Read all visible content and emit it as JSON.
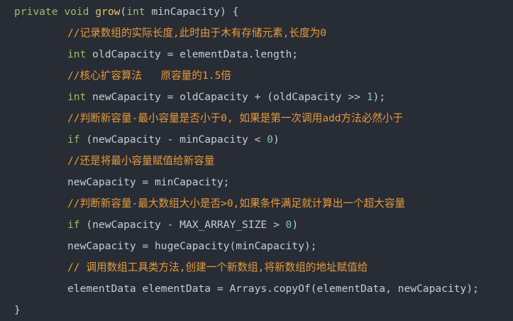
{
  "colors": {
    "background": "#282c34",
    "text": "#c8ccd4",
    "keyword": "#97c06a",
    "function": "#e6c46a",
    "comment": "#e79b3c",
    "number": "#7dc9b1"
  },
  "code": {
    "l1": {
      "kw1": "private",
      "kw2": "void",
      "fn": "grow",
      "p1": "(",
      "kw3": "int",
      "rest": " minCapacity) {"
    },
    "l2": {
      "comment": "//记录数组的实际长度,此时由于木有存储元素,长度为0"
    },
    "l3": {
      "kw": "int",
      "rest": " oldCapacity = elementData.length;"
    },
    "l4": {
      "comment": "//核心扩容算法   原容量的1.5倍"
    },
    "l5": {
      "kw": "int",
      "rest": " newCapacity = oldCapacity + (oldCapacity >> ",
      "num": "1",
      "end": ");"
    },
    "l6": {
      "comment": "//判断新容量-最小容量是否小于0, 如果是第一次调用add方法必然小于"
    },
    "l7": {
      "kw": "if",
      "rest": " (newCapacity - minCapacity < ",
      "num": "0",
      "end": ")"
    },
    "l8": {
      "comment": "//还是将最小容量赋值给新容量"
    },
    "l9": {
      "text": "newCapacity = minCapacity;"
    },
    "l10": {
      "comment": "//判断新容量-最大数组大小是否>0,如果条件满足就计算出一个超大容量"
    },
    "l11": {
      "kw": "if",
      "rest": " (newCapacity - MAX_ARRAY_SIZE > ",
      "num": "0",
      "end": ")"
    },
    "l12": {
      "text": "newCapacity = hugeCapacity(minCapacity);"
    },
    "l13": {
      "comment": "// 调用数组工具类方法,创建一个新数组,将新数组的地址赋值给"
    },
    "l14": {
      "text": "elementData elementData = Arrays.copyOf(elementData, newCapacity);"
    },
    "l15": {
      "text": "}"
    }
  }
}
